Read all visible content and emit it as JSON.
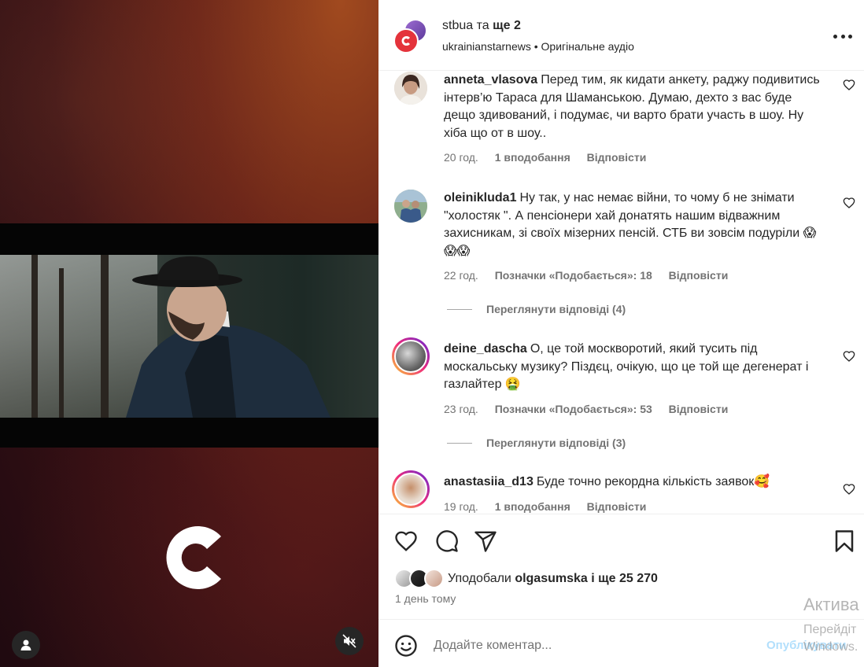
{
  "header": {
    "owner": "stbua",
    "and_text": "та",
    "coauthors": "ще 2",
    "account": "ukrainianstarnews",
    "separator": "•",
    "audio": "Оригінальне аудіо"
  },
  "comments": [
    {
      "user": "anneta_vlasova",
      "text": "Перед тим, як кидати анкету, раджу подивитись інтерв’ю Тараса для Шаманською. Думаю, дехто з вас буде дещо здивований, і подумає, чи варто брати участь в шоу. Ну хіба що от в шоу..",
      "time": "20 год.",
      "likes": "1 вподобання",
      "reply": "Відповісти"
    },
    {
      "user": "oleinikluda1",
      "text": "Ну так, у нас немає війни, то чому б не знімати \"холостяк \". А пенсіонери хай донатять нашим відважним захисникам, зі своїх мізерних пенсій. СТБ ви зовсім подуріли 😱😱😱",
      "time": "22 год.",
      "likes": "Позначки «Подобається»: 18",
      "reply": "Відповісти",
      "view_replies": "Переглянути відповіді (4)"
    },
    {
      "user": "deine_dascha",
      "text": "О, це той москворотий, який тусить під москальську музику? Піздєц, очікую, що це той ще дегенерат і газлайтер 🤮",
      "time": "23 год.",
      "likes": "Позначки «Подобається»: 53",
      "reply": "Відповісти",
      "view_replies": "Переглянути відповіді (3)"
    },
    {
      "user": "anastasiia_d13",
      "text": "Буде точно рекордна кількість заявок🥰",
      "time": "19 год.",
      "likes": "1 вподобання",
      "reply": "Відповісти"
    }
  ],
  "likes": {
    "prefix": "Уподобали",
    "user": "olgasumska",
    "suffix": "і ще 25 270"
  },
  "posted": "1 день тому",
  "composer": {
    "placeholder": "Додайте коментар...",
    "publish": "Опублікувати"
  },
  "watermark": {
    "line1": "Актива",
    "line2": "Перейдіт",
    "line3": "Windows."
  },
  "icons": {
    "more": "more-icon",
    "heart": "heart-icon",
    "comment": "comment-icon",
    "share": "share-icon",
    "save": "bookmark-icon",
    "emoji": "emoji-icon",
    "mute": "mute-icon",
    "user": "user-icon"
  },
  "colors": {
    "text": "#262626",
    "secondary": "#737373",
    "publish_disabled": "#b2dffc",
    "border": "#efefef"
  }
}
